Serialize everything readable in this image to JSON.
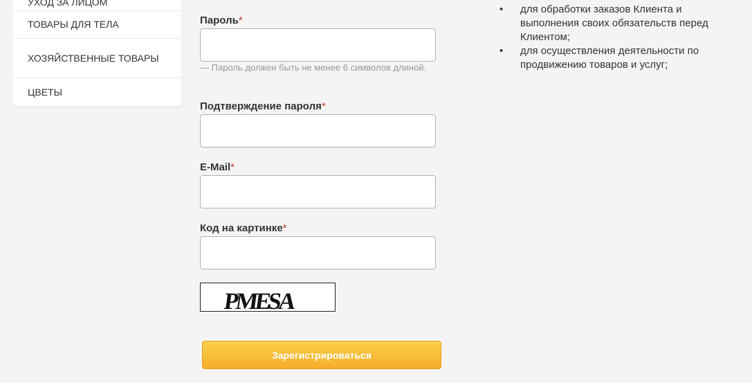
{
  "sidebar": {
    "items": [
      {
        "label": "Уход за лицом"
      },
      {
        "label": "Товары для тела"
      },
      {
        "label": "Хозяйственные товары"
      },
      {
        "label": "Цветы"
      }
    ]
  },
  "form": {
    "password": {
      "label": "Пароль",
      "required_mark": "*",
      "value": "",
      "hint": "— Пароль должен быть не менее 6 символов длиной."
    },
    "password_confirm": {
      "label": "Подтверждение пароля",
      "required_mark": "*",
      "value": ""
    },
    "email": {
      "label": "E-Mail",
      "required_mark": "*",
      "value": ""
    },
    "captcha_code": {
      "label": "Код на картинке",
      "required_mark": "*",
      "value": ""
    },
    "captcha_text": "PMESA",
    "submit_label": "Зарегистрироваться"
  },
  "consent": {
    "bullet": "•",
    "items": [
      {
        "text": "для обработки заказов Клиента и выполнения своих обязательств перед Клиентом;"
      },
      {
        "text": "для осуществления деятельности по продвижению товаров и услуг;"
      }
    ]
  },
  "colors": {
    "required": "#c0392b",
    "button_top": "#fbd04a",
    "button_bottom": "#f5ad2b",
    "border": "#a9b3bd"
  }
}
